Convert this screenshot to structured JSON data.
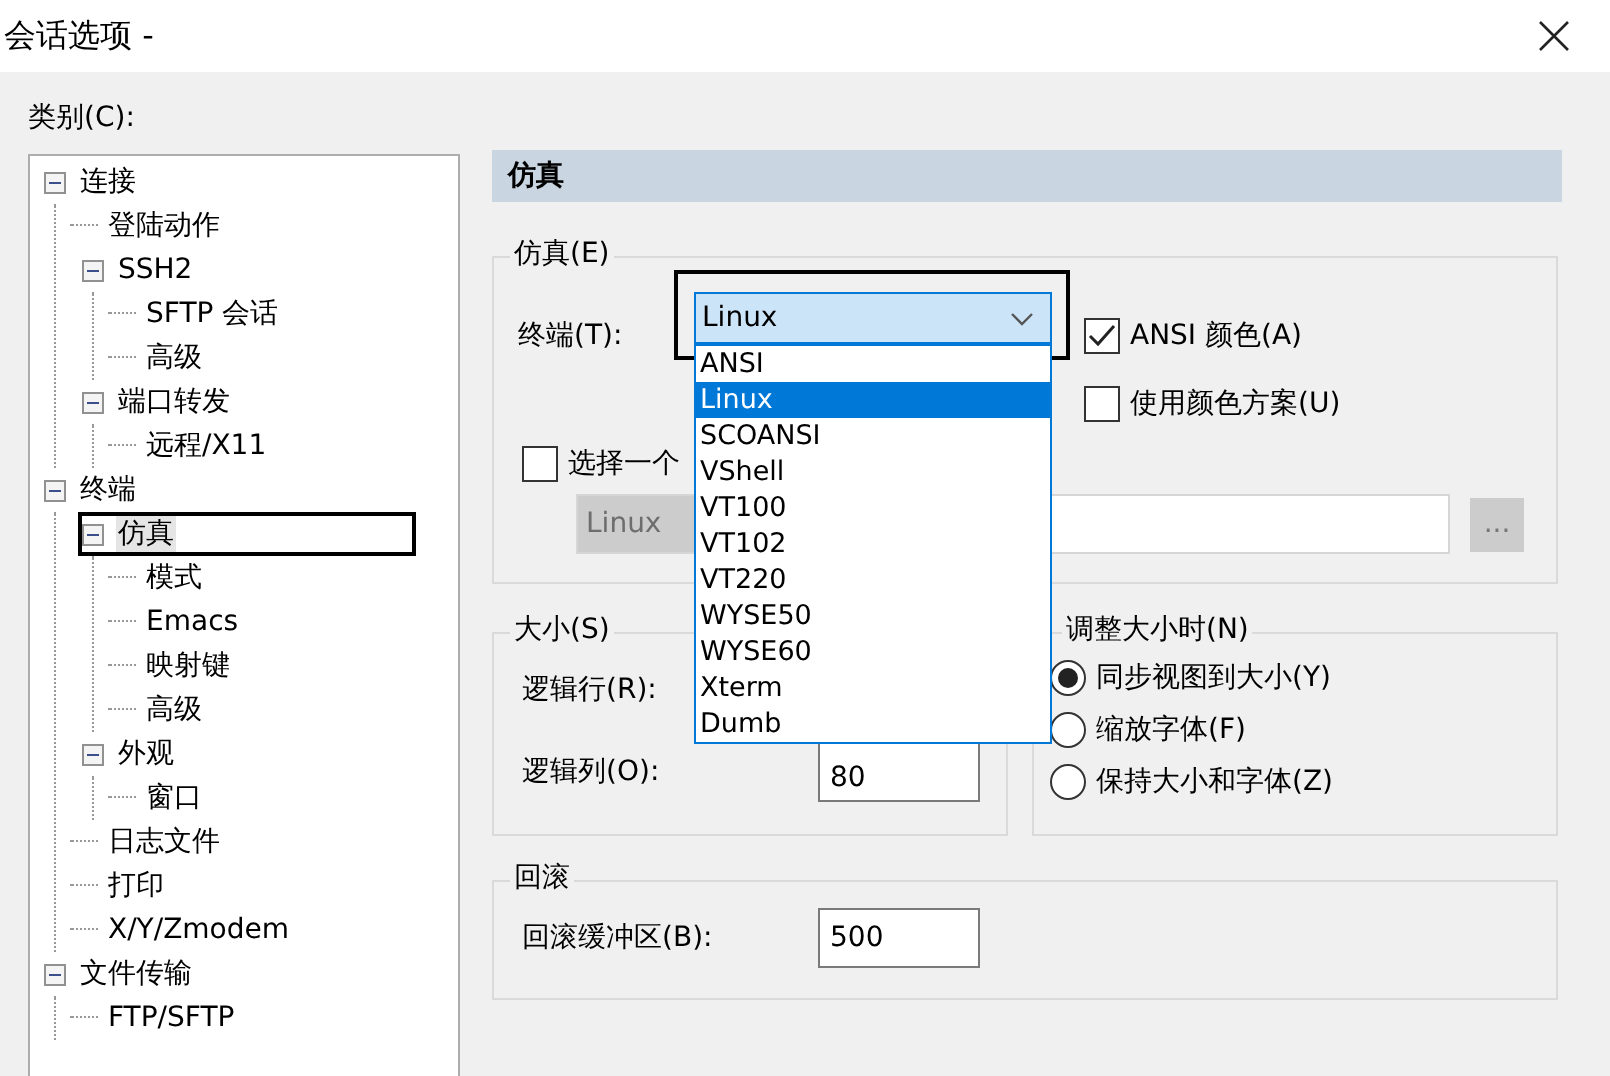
{
  "window": {
    "title": "会话选项 -"
  },
  "category_label": "类别(C):",
  "tree": [
    {
      "label": "连接",
      "expanded": true,
      "selected": false,
      "children": [
        {
          "label": "登陆动作",
          "selected": false
        },
        {
          "label": "SSH2",
          "expanded": true,
          "selected": false,
          "children": [
            {
              "label": "SFTP 会话",
              "selected": false
            },
            {
              "label": "高级",
              "selected": false
            }
          ]
        },
        {
          "label": "端口转发",
          "expanded": true,
          "selected": false,
          "children": [
            {
              "label": "远程/X11",
              "selected": false
            }
          ]
        }
      ]
    },
    {
      "label": "终端",
      "expanded": true,
      "selected": false,
      "children": [
        {
          "label": "仿真",
          "expanded": true,
          "selected": true,
          "children": [
            {
              "label": "模式",
              "selected": false
            },
            {
              "label": "Emacs",
              "selected": false
            },
            {
              "label": "映射键",
              "selected": false
            },
            {
              "label": "高级",
              "selected": false
            }
          ]
        },
        {
          "label": "外观",
          "expanded": true,
          "selected": false,
          "children": [
            {
              "label": "窗口",
              "selected": false
            }
          ]
        },
        {
          "label": "日志文件",
          "selected": false
        },
        {
          "label": "打印",
          "selected": false
        },
        {
          "label": "X/Y/Zmodem",
          "selected": false
        }
      ]
    },
    {
      "label": "文件传输",
      "expanded": true,
      "selected": false,
      "children": [
        {
          "label": "FTP/SFTP",
          "selected": false
        }
      ]
    }
  ],
  "panel_heading": "仿真",
  "emulation_group": {
    "title": "仿真(E)",
    "terminal_label": "终端(T):",
    "terminal_value": "Linux",
    "ansi_color": {
      "label": "ANSI 颜色(A)",
      "checked": true
    },
    "color_scheme": {
      "label": "使用颜色方案(U)",
      "checked": false
    },
    "select_option": {
      "label": "选择一个",
      "checked": false
    },
    "scheme_field": {
      "value": "Linux",
      "disabled": true
    },
    "browse_button": "..."
  },
  "dropdown_options": [
    {
      "label": "ANSI",
      "selected": false
    },
    {
      "label": "Linux",
      "selected": true
    },
    {
      "label": "SCOANSI",
      "selected": false
    },
    {
      "label": "VShell",
      "selected": false
    },
    {
      "label": "VT100",
      "selected": false
    },
    {
      "label": "VT102",
      "selected": false
    },
    {
      "label": "VT220",
      "selected": false
    },
    {
      "label": "WYSE50",
      "selected": false
    },
    {
      "label": "WYSE60",
      "selected": false
    },
    {
      "label": "Xterm",
      "selected": false
    },
    {
      "label": "Dumb",
      "selected": false
    }
  ],
  "size_group": {
    "title": "大小(S)",
    "rows_label": "逻辑行(R):",
    "cols_label": "逻辑列(O):",
    "cols_value": "80"
  },
  "resize_group": {
    "title": "调整大小时(N)",
    "options": [
      {
        "label": "同步视图到大小(Y)",
        "selected": true
      },
      {
        "label": "缩放字体(F)",
        "selected": false
      },
      {
        "label": "保持大小和字体(Z)",
        "selected": false
      }
    ]
  },
  "scrollback_group": {
    "title": "回滚",
    "label": "回滚缓冲区(B):",
    "value": "500"
  }
}
